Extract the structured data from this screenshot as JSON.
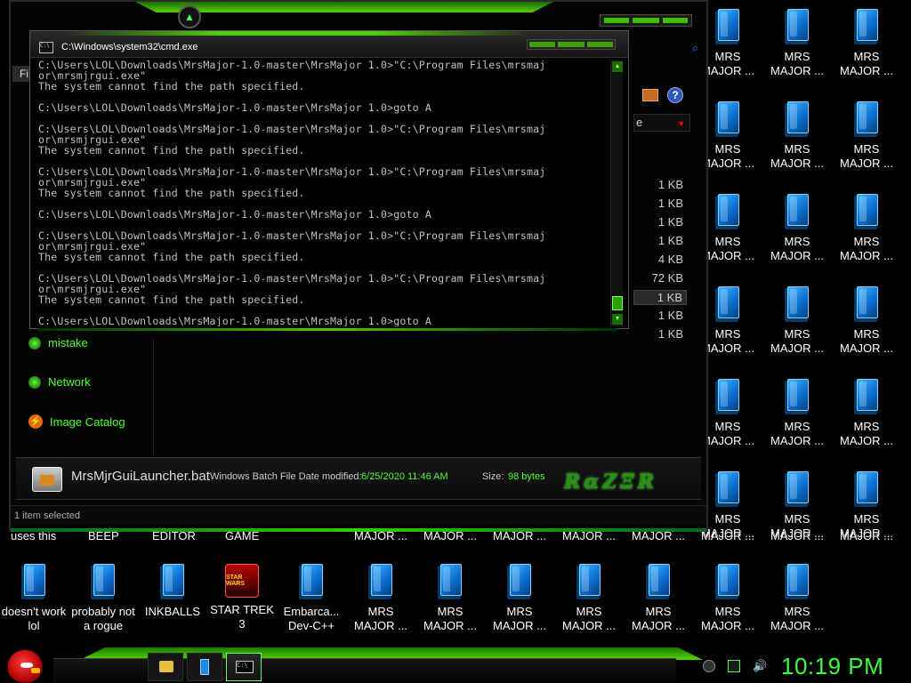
{
  "desktop": {
    "grid_icons": [
      {
        "label": "MRS\nMAJOR ..."
      },
      {
        "label": "MRS\nMAJOR ..."
      },
      {
        "label": "MRS\nMAJOR ..."
      },
      {
        "label": "MRS\nMAJOR ..."
      },
      {
        "label": "MRS\nMAJOR ..."
      },
      {
        "label": "MRS\nMAJOR ..."
      },
      {
        "label": "MRS\nMAJOR ..."
      },
      {
        "label": "MRS\nMAJOR ..."
      },
      {
        "label": "MRS\nMAJOR ..."
      },
      {
        "label": "MRS\nMAJOR ..."
      },
      {
        "label": "MRS\nMAJOR ..."
      },
      {
        "label": "MRS\nMAJOR ..."
      },
      {
        "label": "MRS\nMAJOR ..."
      },
      {
        "label": "MRS\nMAJOR ..."
      },
      {
        "label": "MRS\nMAJOR ..."
      },
      {
        "label": "MRS\nMAJOR ..."
      },
      {
        "label": "MRS\nMAJOR ..."
      },
      {
        "label": "MRS\nMAJOR ..."
      }
    ],
    "row_labels": [
      "uses this",
      "BEEP",
      "EDITOR",
      "GAME",
      "MAJOR ...",
      "MAJOR ...",
      "MAJOR ...",
      "MAJOR ...",
      "MAJOR ...",
      "MAJOR ...",
      "MAJOR ...",
      "MAJOR ..."
    ],
    "bottom_icons": [
      {
        "label": "doesn't work\nlol"
      },
      {
        "label": "probably not\na rogue"
      },
      {
        "label": "INKBALLS"
      },
      {
        "label": "STAR TREK\n3"
      },
      {
        "label": "Embarca...\nDev-C++"
      },
      {
        "label": "MRS\nMAJOR ..."
      },
      {
        "label": "MRS\nMAJOR ..."
      },
      {
        "label": "MRS\nMAJOR ..."
      },
      {
        "label": "MRS\nMAJOR ..."
      },
      {
        "label": "MRS\nMAJOR ..."
      },
      {
        "label": "MRS\nMAJOR ..."
      },
      {
        "label": "MRS\nMAJOR ..."
      }
    ],
    "game_icon_text": "STAR WARS"
  },
  "explorer": {
    "menu_file": "Fi",
    "sort_label": "e",
    "sidebar": [
      {
        "label": "mistake",
        "icon": "network-bullet-icon"
      },
      {
        "label": "Network",
        "icon": "network-icon"
      },
      {
        "label": "Image Catalog",
        "icon": "image-catalog-icon"
      }
    ],
    "sizes": [
      "1 KB",
      "1 KB",
      "1 KB",
      "1 KB",
      "4 KB",
      "72 KB",
      "1 KB",
      "1 KB",
      "1 KB"
    ],
    "selected_size_index": 6,
    "details": {
      "file_name": "MrsMjrGuiLauncher.bat",
      "file_type": "Windows Batch File",
      "date_label": "Date modified:",
      "date_value": "6/25/2020 11:46 AM",
      "size_label": "Size:",
      "size_value": "98 bytes",
      "logo": "RAZER"
    },
    "status": "1 item selected"
  },
  "cmd": {
    "title": "C:\\Windows\\system32\\cmd.exe",
    "icon_text": "C:\\",
    "lines": [
      "C:\\Users\\LOL\\Downloads\\MrsMajor-1.0-master\\MrsMajor 1.0>\"C:\\Program Files\\mrsmaj",
      "or\\mrsmjrgui.exe\"",
      "The system cannot find the path specified.",
      "",
      "C:\\Users\\LOL\\Downloads\\MrsMajor-1.0-master\\MrsMajor 1.0>goto A",
      "",
      "C:\\Users\\LOL\\Downloads\\MrsMajor-1.0-master\\MrsMajor 1.0>\"C:\\Program Files\\mrsmaj",
      "or\\mrsmjrgui.exe\"",
      "The system cannot find the path specified.",
      "",
      "C:\\Users\\LOL\\Downloads\\MrsMajor-1.0-master\\MrsMajor 1.0>\"C:\\Program Files\\mrsmaj",
      "or\\mrsmjrgui.exe\"",
      "The system cannot find the path specified.",
      "",
      "C:\\Users\\LOL\\Downloads\\MrsMajor-1.0-master\\MrsMajor 1.0>goto A",
      "",
      "C:\\Users\\LOL\\Downloads\\MrsMajor-1.0-master\\MrsMajor 1.0>\"C:\\Program Files\\mrsmaj",
      "or\\mrsmjrgui.exe\"",
      "The system cannot find the path specified.",
      "",
      "C:\\Users\\LOL\\Downloads\\MrsMajor-1.0-master\\MrsMajor 1.0>\"C:\\Program Files\\mrsmaj",
      "or\\mrsmjrgui.exe\"",
      "The system cannot find the path specified.",
      "",
      "C:\\Users\\LOL\\Downloads\\MrsMajor-1.0-master\\MrsMajor 1.0>goto A"
    ]
  },
  "taskbar": {
    "clock": "10:19 PM",
    "buttons": [
      "folder-icon",
      "file-icon",
      "cmd-icon"
    ]
  },
  "colors": {
    "accent_green": "#3cff3c",
    "file_blue": "#0d6fd1"
  }
}
